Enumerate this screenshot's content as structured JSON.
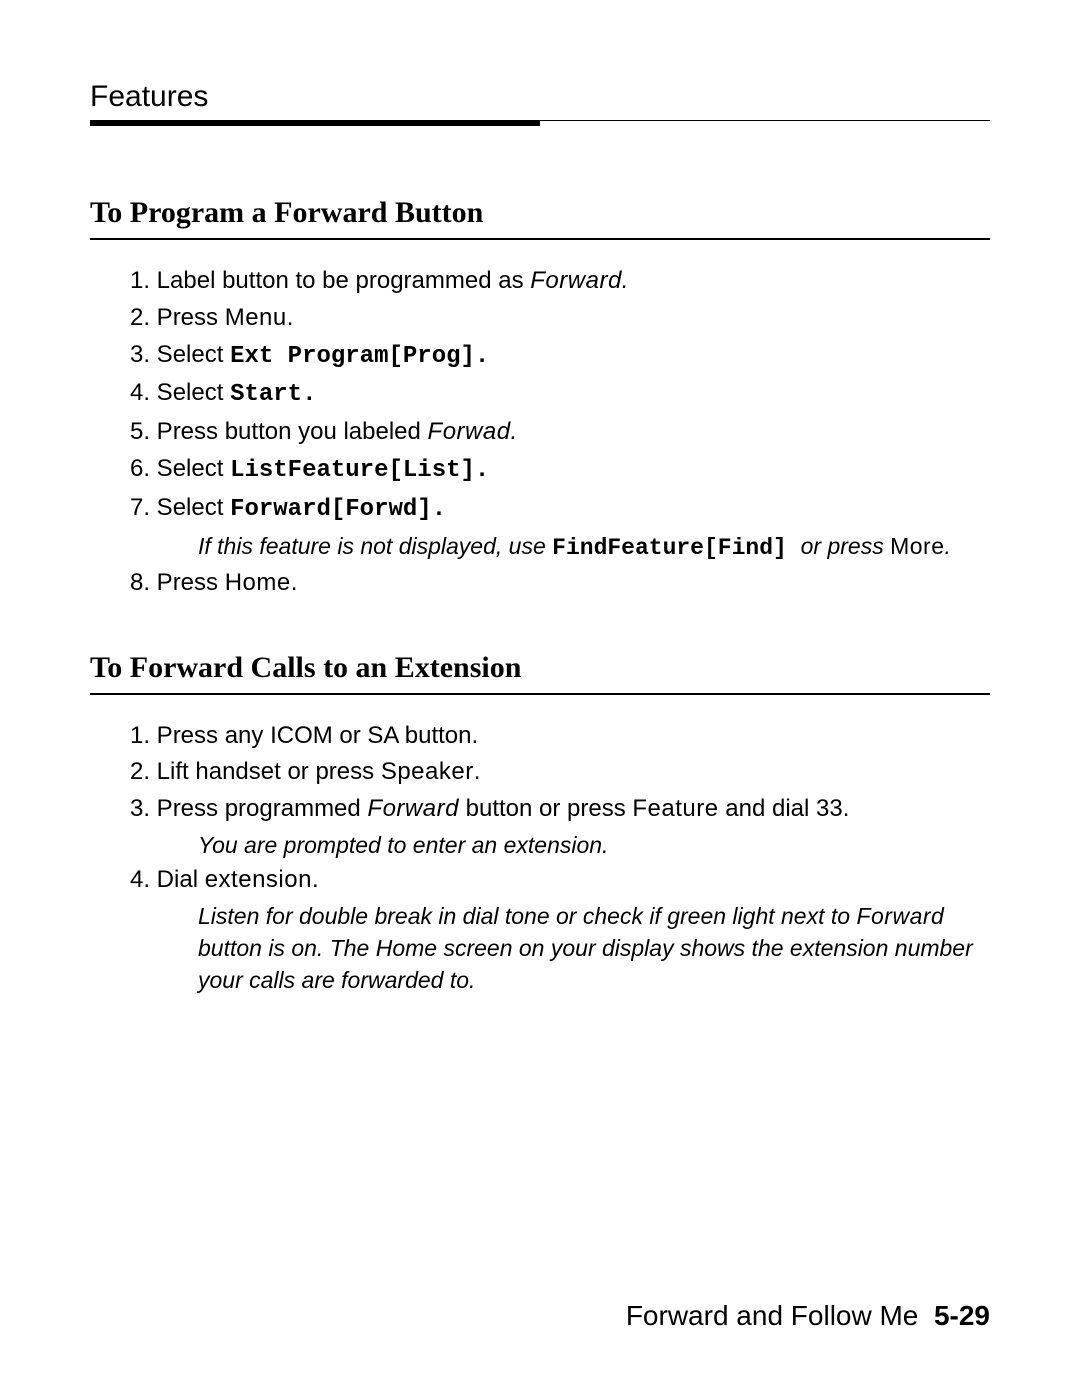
{
  "header": {
    "chapter": "Features"
  },
  "section1": {
    "title": "To Program a Forward Button",
    "steps": [
      {
        "num": "1.",
        "pre": " Label button to be programmed as ",
        "em": "Forward.",
        "post": ""
      },
      {
        "num": "2.",
        "pre": " Press ",
        "em": "Menu",
        "post": "."
      },
      {
        "num": "3.",
        "pre": " Select ",
        "code": "Ext Program[Prog].",
        "post": ""
      },
      {
        "num": "4.",
        "pre": " Select ",
        "code": "Start.",
        "post": ""
      },
      {
        "num": "5.",
        "pre": " Press button you labeled ",
        "em": "Forwad.",
        "post": ""
      },
      {
        "num": "6.",
        "pre": " Select ",
        "code": "ListFeature[List].",
        "post": ""
      },
      {
        "num": "7.",
        "pre": " Select ",
        "code": "Forward[Forwd].",
        "post": "",
        "note_pre": "If this feature is not displayed, use ",
        "note_code": "FindFeature[Find] ",
        "note_mid": " or press ",
        "note_em": "More",
        "note_post": "."
      },
      {
        "num": "8.",
        "pre": " Press ",
        "em": "Home",
        "post": "."
      }
    ]
  },
  "section2": {
    "title": "To Forward Calls to an Extension",
    "steps": [
      {
        "num": "1.",
        "full": " Press any ICOM or SA button."
      },
      {
        "num": "2.",
        "pre": " Lift handset or press ",
        "em": "Speaker",
        "post": "."
      },
      {
        "num": "3.",
        "pre": " Press programmed ",
        "em": "Forward",
        "mid": " button or press ",
        "em2": "Feature",
        "post2": " and dial 33.",
        "note_plain": "You are prompted to enter an extension."
      },
      {
        "num": "4.",
        "pre": " Dial ",
        "em": "extension",
        "post": ".",
        "note_pre": "Listen for double break in dial tone or check if green light next to ",
        "note_em": "Forward",
        "note_post": " button is on. The Home screen on your display shows the extension number your calls are forwarded to."
      }
    ]
  },
  "footer": {
    "title": "Forward and Follow Me",
    "page": "5-29"
  }
}
